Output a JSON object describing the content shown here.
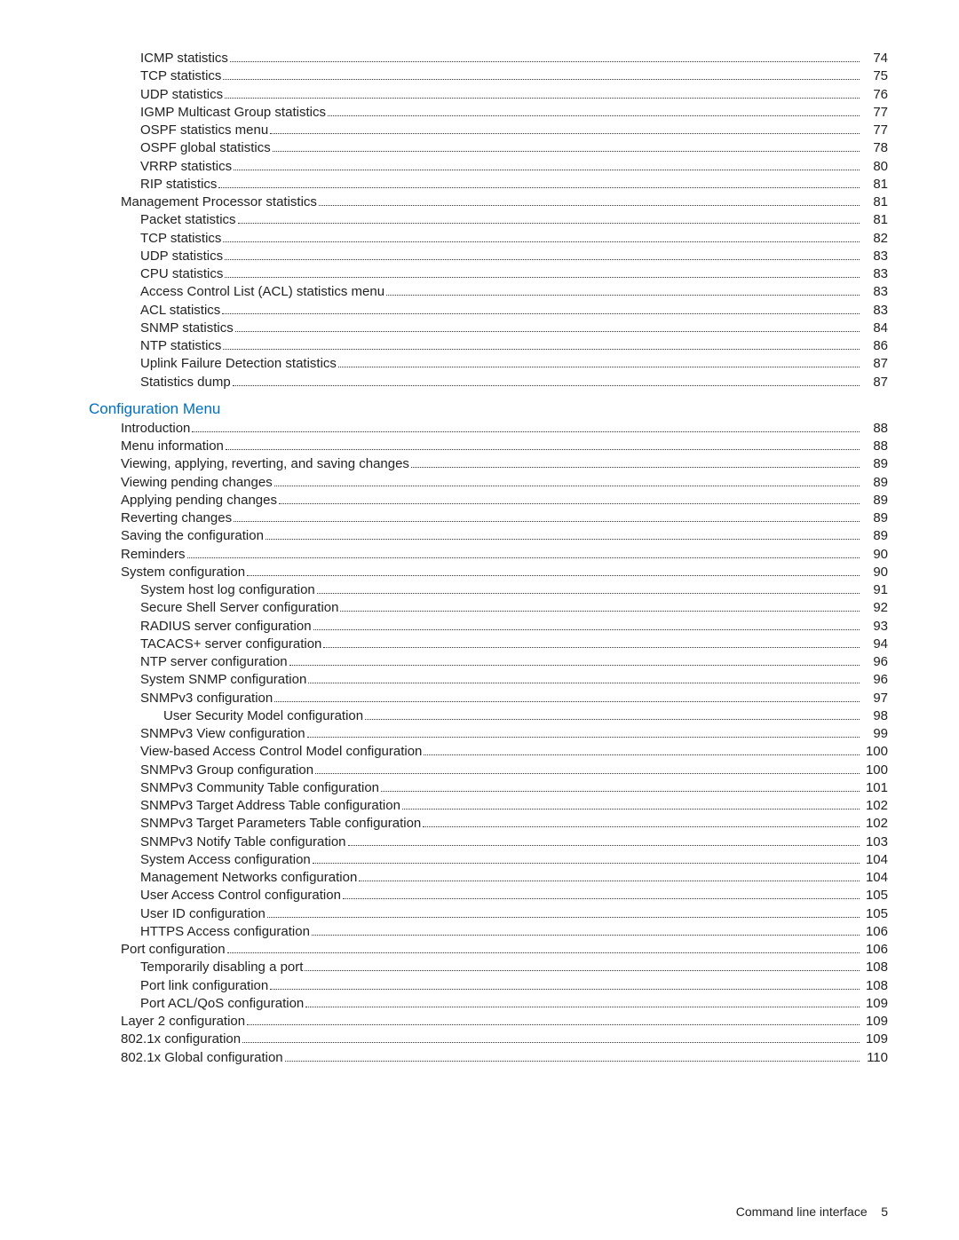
{
  "sections": [
    {
      "heading": null,
      "items": [
        {
          "label": "ICMP statistics",
          "page": "74",
          "indent": 2
        },
        {
          "label": "TCP statistics",
          "page": "75",
          "indent": 2
        },
        {
          "label": "UDP statistics",
          "page": "76",
          "indent": 2
        },
        {
          "label": "IGMP Multicast Group statistics",
          "page": "77",
          "indent": 2
        },
        {
          "label": "OSPF statistics menu",
          "page": "77",
          "indent": 2
        },
        {
          "label": "OSPF global statistics",
          "page": "78",
          "indent": 2
        },
        {
          "label": "VRRP statistics",
          "page": "80",
          "indent": 2
        },
        {
          "label": "RIP statistics",
          "page": "81",
          "indent": 2
        },
        {
          "label": "Management Processor statistics",
          "page": "81",
          "indent": 1
        },
        {
          "label": "Packet statistics",
          "page": "81",
          "indent": 2
        },
        {
          "label": "TCP statistics",
          "page": "82",
          "indent": 2
        },
        {
          "label": "UDP statistics",
          "page": "83",
          "indent": 2
        },
        {
          "label": "CPU statistics",
          "page": "83",
          "indent": 2
        },
        {
          "label": "Access Control List (ACL) statistics menu",
          "page": "83",
          "indent": 2
        },
        {
          "label": "ACL statistics",
          "page": "83",
          "indent": 2
        },
        {
          "label": "SNMP statistics",
          "page": "84",
          "indent": 2
        },
        {
          "label": "NTP statistics",
          "page": "86",
          "indent": 2
        },
        {
          "label": "Uplink Failure Detection statistics",
          "page": "87",
          "indent": 2
        },
        {
          "label": "Statistics dump",
          "page": "87",
          "indent": 2
        }
      ]
    },
    {
      "heading": "Configuration Menu",
      "items": [
        {
          "label": "Introduction",
          "page": "88",
          "indent": 1
        },
        {
          "label": "Menu information",
          "page": "88",
          "indent": 1
        },
        {
          "label": "Viewing, applying, reverting, and saving changes",
          "page": "89",
          "indent": 1
        },
        {
          "label": "Viewing pending changes",
          "page": "89",
          "indent": 1
        },
        {
          "label": "Applying pending changes",
          "page": "89",
          "indent": 1
        },
        {
          "label": "Reverting changes",
          "page": "89",
          "indent": 1
        },
        {
          "label": "Saving the configuration",
          "page": "89",
          "indent": 1
        },
        {
          "label": "Reminders",
          "page": "90",
          "indent": 1
        },
        {
          "label": "System configuration",
          "page": "90",
          "indent": 1
        },
        {
          "label": "System host log configuration",
          "page": "91",
          "indent": 2
        },
        {
          "label": "Secure Shell Server configuration",
          "page": "92",
          "indent": 2
        },
        {
          "label": "RADIUS server configuration",
          "page": "93",
          "indent": 2
        },
        {
          "label": "TACACS+ server configuration",
          "page": "94",
          "indent": 2
        },
        {
          "label": "NTP server configuration",
          "page": "96",
          "indent": 2
        },
        {
          "label": "System SNMP configuration",
          "page": "96",
          "indent": 2
        },
        {
          "label": "SNMPv3 configuration",
          "page": "97",
          "indent": 2
        },
        {
          "label": "User Security Model configuration",
          "page": "98",
          "indent": 3
        },
        {
          "label": "SNMPv3 View configuration",
          "page": "99",
          "indent": 2
        },
        {
          "label": "View-based Access Control Model configuration",
          "page": "100",
          "indent": 2
        },
        {
          "label": "SNMPv3 Group configuration",
          "page": "100",
          "indent": 2
        },
        {
          "label": "SNMPv3 Community Table configuration",
          "page": "101",
          "indent": 2
        },
        {
          "label": "SNMPv3 Target Address Table configuration",
          "page": "102",
          "indent": 2
        },
        {
          "label": "SNMPv3 Target Parameters Table configuration",
          "page": "102",
          "indent": 2
        },
        {
          "label": "SNMPv3 Notify Table configuration",
          "page": "103",
          "indent": 2
        },
        {
          "label": "System Access configuration",
          "page": "104",
          "indent": 2
        },
        {
          "label": "Management Networks configuration",
          "page": "104",
          "indent": 2
        },
        {
          "label": "User Access Control configuration",
          "page": "105",
          "indent": 2
        },
        {
          "label": "User ID configuration",
          "page": "105",
          "indent": 2
        },
        {
          "label": "HTTPS Access configuration",
          "page": "106",
          "indent": 2
        },
        {
          "label": "Port configuration",
          "page": "106",
          "indent": 1
        },
        {
          "label": "Temporarily disabling a port",
          "page": "108",
          "indent": 2
        },
        {
          "label": "Port link configuration",
          "page": "108",
          "indent": 2
        },
        {
          "label": "Port ACL/QoS configuration",
          "page": "109",
          "indent": 2
        },
        {
          "label": "Layer 2 configuration",
          "page": "109",
          "indent": 1
        },
        {
          "label": "802.1x configuration",
          "page": "109",
          "indent": 1
        },
        {
          "label": "802.1x Global configuration",
          "page": "110",
          "indent": 1
        }
      ]
    }
  ],
  "footer": {
    "label": "Command line interface",
    "page": "5"
  }
}
